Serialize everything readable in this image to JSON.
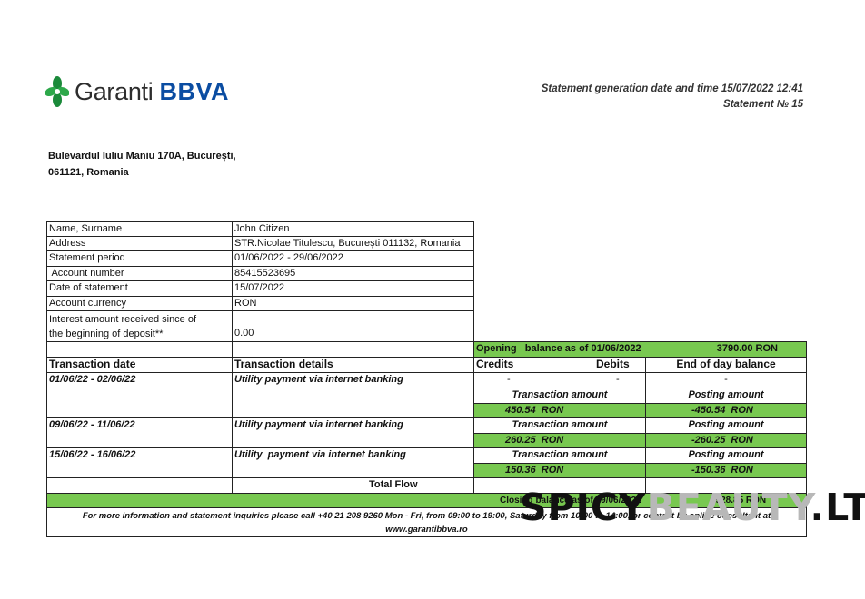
{
  "logo": {
    "garanti": "Garanti",
    "bbva": "BBVA",
    "colors": [
      "#1b8a3a",
      "#0b4da2"
    ]
  },
  "statement": {
    "generation": "Statement generation date and time 15/07/2022 12:41",
    "number": "Statement № 15"
  },
  "bank_address": {
    "line1": "Bulevardul Iuliu Maniu 170A, București,",
    "line2": "061121, Romania"
  },
  "info": [
    {
      "label": "Name, Surname",
      "value": "John Citizen"
    },
    {
      "label": "Address",
      "value": "STR.Nicolae Titulescu, București 011132, Romania"
    },
    {
      "label": "Statement period",
      "value": "01/06/2022 - 29/06/2022"
    },
    {
      "label": " Account number",
      "value": "85415523695"
    },
    {
      "label": "Date of statement",
      "value": "15/07/2022"
    },
    {
      "label": "Account currency",
      "value": "RON"
    },
    {
      "label_line1": "Interest amount received since of",
      "label_line2": "the beginning of deposit**",
      "value": "0.00"
    }
  ],
  "opening": {
    "label": "Opening   balance as of 01/06/2022",
    "value": "3790.00 RON"
  },
  "headers": {
    "date": "Transaction date",
    "details": "Transaction details",
    "credits": "Credits",
    "debits": "Debits",
    "balance": "End of day balance"
  },
  "dash": "-",
  "transactions": [
    {
      "date": "01/06/22 - 02/06/22",
      "details": "Utility payment via internet banking",
      "amount_label": "Transaction amount",
      "posting_label": "Posting amount",
      "amount": "450.54  RON",
      "posting": "-450.54  RON"
    },
    {
      "date": "09/06/22 - 11/06/22",
      "details": "Utility payment via internet banking",
      "amount_label": "Transaction amount",
      "posting_label": "Posting amount",
      "amount": "260.25  RON",
      "posting": "-260.25  RON"
    },
    {
      "date": "15/06/22 - 16/06/22",
      "details": "Utility  payment via internet banking",
      "amount_label": "Transaction amount",
      "posting_label": "Posting amount",
      "amount": "150.36  RON",
      "posting": "-150.36  RON"
    }
  ],
  "total_flow": "Total Flow",
  "closing": {
    "label": "Closing balance as of 29/06/2022",
    "value": "2928.85 RON"
  },
  "footer": {
    "line1": "For more information and statement inquiries please call +40 21 208 9260 Mon - Fri, from 09:00 to 19:00, Saturday from 10:00 to 14:00, or contact by online consultant at",
    "line2": "www.garantibbva.ro"
  },
  "watermark": {
    "part1": "SPICY",
    "part2": "BEAUTY",
    "part3": ".LT"
  }
}
